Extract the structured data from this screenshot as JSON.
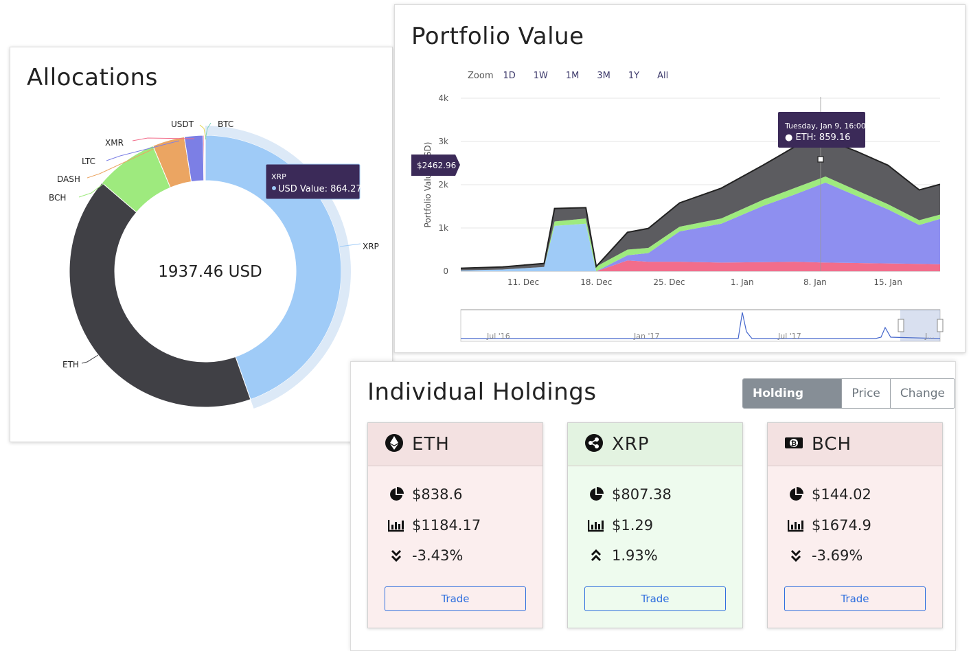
{
  "allocations": {
    "title": "Allocations",
    "center_label": "1937.46 USD",
    "tooltip": {
      "coin": "XRP",
      "line": "USD Value: 864.27"
    },
    "labels": [
      "USDT",
      "BTC",
      "XMR",
      "LTC",
      "DASH",
      "BCH",
      "XRP",
      "ETH"
    ],
    "chart_data": {
      "type": "pie",
      "labels": [
        "XRP",
        "ETH",
        "BCH",
        "DASH",
        "LTC",
        "XMR",
        "USDT",
        "BTC"
      ],
      "values": [
        864.27,
        807.4,
        144.02,
        74.0,
        43.0,
        2.5,
        1.5,
        1.0
      ],
      "total": 1937.46,
      "colors": [
        "#9fcbf7",
        "#404045",
        "#9eea7e",
        "#eba562",
        "#7c7fe5",
        "#f26d8b",
        "#e2d54f",
        "#7fd3c0"
      ]
    }
  },
  "portfolio": {
    "title": "Portfolio Value",
    "zoom_label": "Zoom",
    "zoom_options": [
      "1D",
      "1W",
      "1M",
      "3M",
      "1Y",
      "All"
    ],
    "y_axis_title": "Portfolio Value (USD)",
    "crosshair_label": "$2462.96",
    "tooltip": {
      "date": "Tuesday, Jan 9, 16:00",
      "line": "● ETH: 859.16"
    },
    "navigator_labels": [
      "Jul '16",
      "Jan '17",
      "Jul '17",
      "J..."
    ],
    "chart_data": {
      "type": "area",
      "stacked": true,
      "title": "Portfolio Value",
      "ylabel": "Portfolio Value (USD)",
      "ylim": [
        0,
        4000
      ],
      "yticks": [
        "0",
        "1k",
        "2k",
        "3k",
        "4k"
      ],
      "xlim": [
        "2017-12-05",
        "2018-01-20"
      ],
      "xticks": [
        "11. Dec",
        "18. Dec",
        "25. Dec",
        "1. Jan",
        "8. Jan",
        "15. Jan"
      ],
      "x": [
        "2017-12-05",
        "2017-12-09",
        "2017-12-13",
        "2017-12-14",
        "2017-12-17",
        "2017-12-18",
        "2017-12-21",
        "2017-12-23",
        "2017-12-26",
        "2017-12-30",
        "2018-01-03",
        "2018-01-06",
        "2018-01-09",
        "2018-01-12",
        "2018-01-15",
        "2018-01-18",
        "2018-01-20"
      ],
      "series": [
        {
          "name": "BCH",
          "color": "#f26d8b",
          "values": [
            0,
            0,
            0,
            0,
            0,
            0,
            250,
            220,
            220,
            200,
            210,
            220,
            200,
            190,
            180,
            170,
            160
          ]
        },
        {
          "name": "XRP",
          "color": "#9fcbf7",
          "values": [
            20,
            40,
            100,
            1050,
            1100,
            0,
            0,
            0,
            0,
            0,
            0,
            0,
            0,
            0,
            0,
            0,
            0
          ]
        },
        {
          "name": "XRP ",
          "color": "#8e8ff0",
          "values": [
            0,
            0,
            0,
            0,
            0,
            0,
            120,
            200,
            700,
            900,
            1300,
            1550,
            1850,
            1550,
            1250,
            900,
            1050
          ]
        },
        {
          "name": "LTC",
          "color": "#9eea7e",
          "values": [
            0,
            0,
            0,
            100,
            120,
            110,
            130,
            120,
            110,
            120,
            140,
            150,
            140,
            130,
            120,
            110,
            100
          ]
        },
        {
          "name": "ETH",
          "color": "#5c5c60",
          "values": [
            50,
            60,
            80,
            300,
            250,
            0,
            400,
            450,
            550,
            700,
            800,
            950,
            859.16,
            900,
            900,
            700,
            700
          ]
        }
      ],
      "grid": true
    }
  },
  "holdings": {
    "title": "Individual Holdings",
    "toggle": [
      "Holding Size",
      "Price",
      "Change"
    ],
    "active_toggle": "Holding Size",
    "cards": [
      {
        "coin": "ETH",
        "icon": "ethereum-icon",
        "value": "$838.6",
        "price": "$1184.17",
        "change": "-3.43%",
        "trend": "down",
        "head_bg": "#f3e1e1",
        "body_bg": "#fbeeee",
        "trade": "Trade"
      },
      {
        "coin": "XRP",
        "icon": "ripple-icon",
        "value": "$807.38",
        "price": "$1.29",
        "change": "1.93%",
        "trend": "up",
        "head_bg": "#e3f3e1",
        "body_bg": "#eefbee",
        "trade": "Trade"
      },
      {
        "coin": "BCH",
        "icon": "bitcoin-cash-icon",
        "value": "$144.02",
        "price": "$1674.9",
        "change": "-3.69%",
        "trend": "down",
        "head_bg": "#f3e1e1",
        "body_bg": "#fbeeee",
        "trade": "Trade"
      }
    ]
  }
}
